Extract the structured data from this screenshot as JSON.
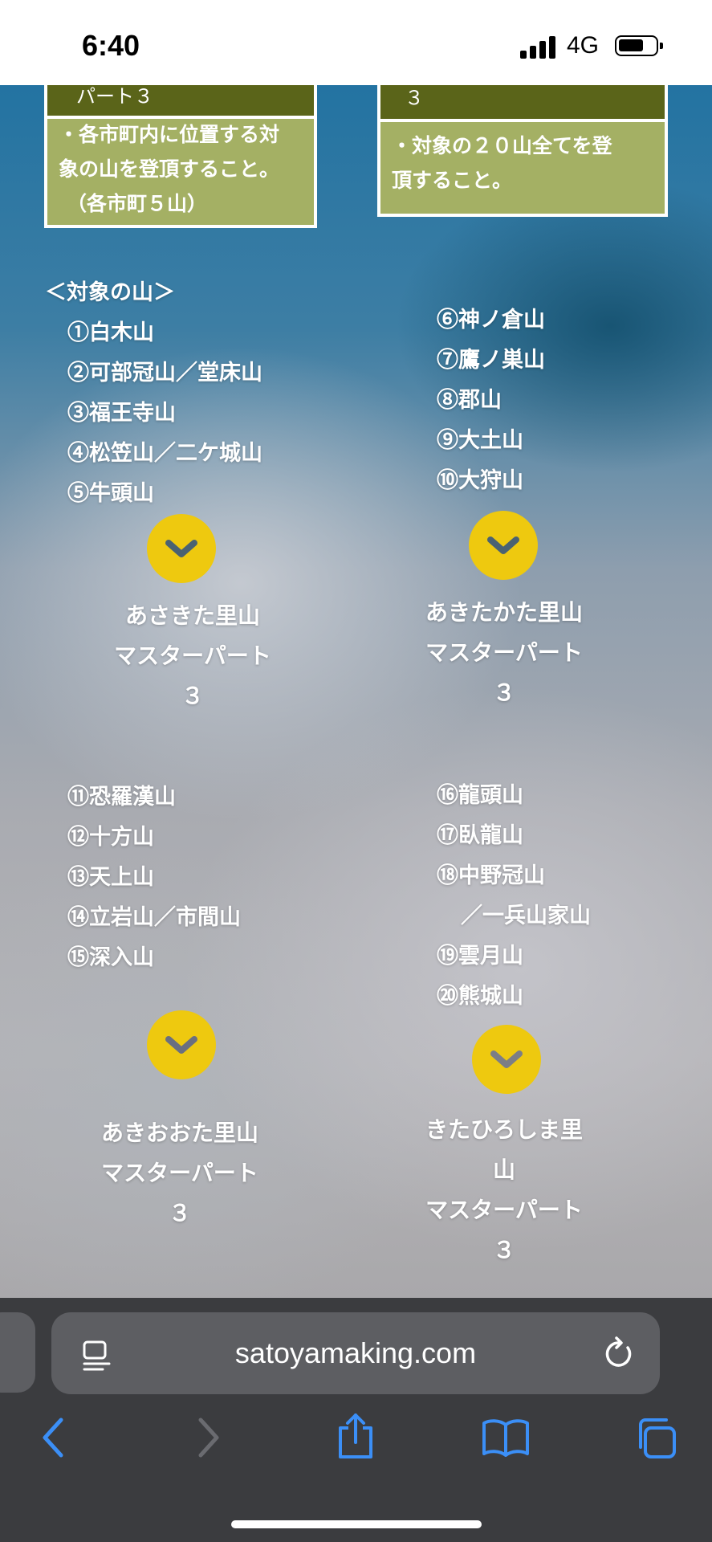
{
  "status_bar": {
    "time": "6:40",
    "network": "4G"
  },
  "cards": [
    {
      "band": "パート３",
      "desc": [
        "・各市町内に位置する対",
        "象の山を登頂すること。",
        "（各市町５山）"
      ]
    },
    {
      "band": "３",
      "desc": [
        "・対象の２０山全てを登",
        "頂すること。"
      ]
    }
  ],
  "mountains_header": "＜対象の山＞",
  "mountain_groups": [
    [
      "①白木山",
      "②可部冠山／堂床山",
      "③福王寺山",
      "④松笠山／二ケ城山",
      "⑤牛頭山"
    ],
    [
      "⑥神ノ倉山",
      "⑦鷹ノ巣山",
      "⑧郡山",
      "⑨大土山",
      "⑩大狩山"
    ],
    [
      "⑪恐羅漢山",
      "⑫十方山",
      "⑬天上山",
      "⑭立岩山／市間山",
      "⑮深入山"
    ],
    [
      "⑯龍頭山",
      "⑰臥龍山",
      "⑱中野冠山",
      "／一兵山家山",
      "⑲雲月山",
      "⑳熊城山"
    ]
  ],
  "course_titles": [
    [
      "あさきた里山",
      "マスターパート",
      "３"
    ],
    [
      "あきたかた里山",
      "マスターパート",
      "３"
    ],
    [
      "あきおおた里山",
      "マスターパート",
      "３"
    ],
    [
      "きたひろしま里",
      "山",
      "マスターパート",
      "３"
    ]
  ],
  "browser": {
    "url": "satoyamaking.com"
  },
  "colors": {
    "card_bg": "#a4b064",
    "card_band": "#5a6419",
    "chevron_button": "#eec90f"
  }
}
